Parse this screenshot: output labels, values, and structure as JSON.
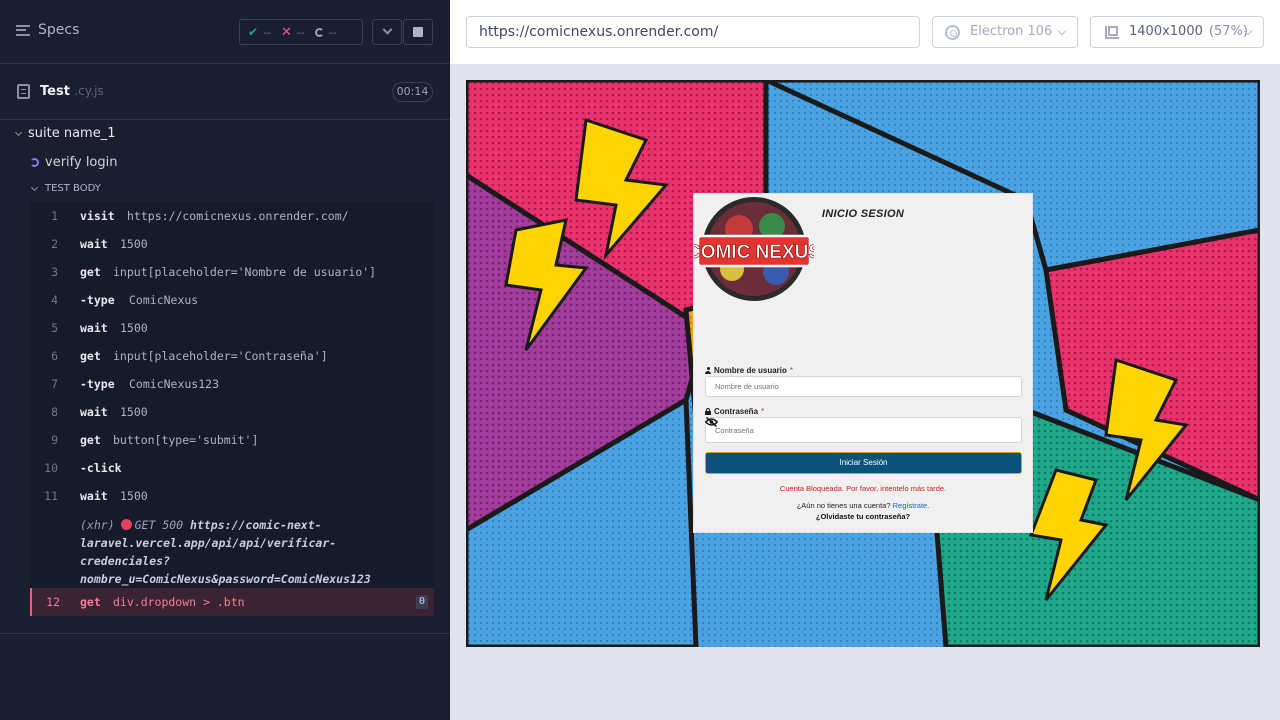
{
  "reporter": {
    "specs_label": "Specs",
    "stats": {
      "passed": "--",
      "failed": "--",
      "pending": "--"
    },
    "file": {
      "name": "Test",
      "ext": ".cy.js",
      "duration": "00:14"
    },
    "suite": {
      "name": "suite name_1"
    },
    "test": {
      "name": "verify login"
    },
    "body_label": "TEST BODY",
    "commands": [
      {
        "num": "1",
        "name": "visit",
        "message": "https://comicnexus.onrender.com/"
      },
      {
        "num": "2",
        "name": "wait",
        "message": "1500"
      },
      {
        "num": "3",
        "name": "get",
        "message": "input[placeholder='Nombre de usuario']"
      },
      {
        "num": "4",
        "name": "-type",
        "message": "ComicNexus"
      },
      {
        "num": "5",
        "name": "wait",
        "message": "1500"
      },
      {
        "num": "6",
        "name": "get",
        "message": "input[placeholder='Contraseña']"
      },
      {
        "num": "7",
        "name": "-type",
        "message": "ComicNexus123"
      },
      {
        "num": "8",
        "name": "wait",
        "message": "1500"
      },
      {
        "num": "9",
        "name": "get",
        "message": "button[type='submit']"
      },
      {
        "num": "10",
        "name": "-click",
        "message": ""
      },
      {
        "num": "11",
        "name": "wait",
        "message": "1500"
      }
    ],
    "xhr": {
      "label": "(xhr)",
      "method_status": "GET 500",
      "url_line1": "https://comic-next-",
      "url_line2": "laravel.vercel.app/api/api/verificar-",
      "url_line3": "credenciales?",
      "url_line4": "nombre_u=ComicNexus&password=ComicNexus123"
    },
    "failed_command": {
      "num": "12",
      "name": "get",
      "message": "div.dropdown > .btn",
      "count": "0"
    }
  },
  "toolbar": {
    "url": "https://comicnexus.onrender.com/",
    "browser": "Electron 106",
    "viewport": "1400x1000",
    "zoom": "(57%)"
  },
  "app": {
    "title": "INICIO SESION",
    "logo_text": "COMIC NEXUS",
    "username_label": "Nombre de usuario",
    "username_placeholder": "Nombre de usuario",
    "password_label": "Contraseña",
    "password_placeholder": "Contraseña",
    "required_mark": "*",
    "submit_label": "Iniciar Sesión",
    "error_message": "Cuenta Bloqueada. Por favor, intentelo más tarde.",
    "signup_prompt": "¿Aún no tienes una cuenta?",
    "signup_link": "Regístrate.",
    "forgot_link": "¿Olvidaste tu contraseña?"
  },
  "colors": {
    "reporter_bg": "#1b1e2e",
    "failed_accent": "#f15b7a",
    "button_bg": "#0c5177",
    "error_red": "#d21c1c"
  }
}
